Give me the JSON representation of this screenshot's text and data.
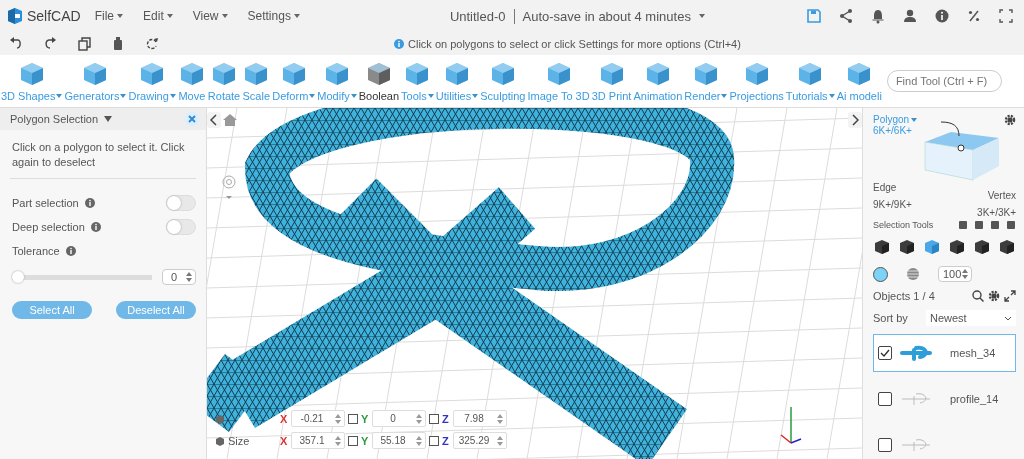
{
  "app": {
    "logo": "SelfCAD",
    "menus": [
      {
        "label": "File"
      },
      {
        "label": "Edit"
      },
      {
        "label": "View"
      },
      {
        "label": "Settings"
      }
    ],
    "document_title": "Untitled-0",
    "autosave": "Auto-save in about 4 minutes"
  },
  "hint": "Click on polygons to select or click Settings for more options (Ctrl+4)",
  "tools": [
    {
      "label": "3D Shapes",
      "dropdown": true,
      "muted": false
    },
    {
      "label": "Generators",
      "dropdown": true,
      "muted": false
    },
    {
      "label": "Drawing",
      "dropdown": true,
      "muted": false
    },
    {
      "label": "Move",
      "dropdown": false,
      "muted": false
    },
    {
      "label": "Rotate",
      "dropdown": false,
      "muted": false
    },
    {
      "label": "Scale",
      "dropdown": false,
      "muted": false
    },
    {
      "label": "Deform",
      "dropdown": true,
      "muted": false
    },
    {
      "label": "Modify",
      "dropdown": true,
      "muted": false
    },
    {
      "label": "Boolean",
      "dropdown": false,
      "muted": true
    },
    {
      "label": "Tools",
      "dropdown": true,
      "muted": false
    },
    {
      "label": "Utilities",
      "dropdown": true,
      "muted": false
    },
    {
      "label": "Sculpting",
      "dropdown": false,
      "muted": false
    },
    {
      "label": "Image To 3D",
      "dropdown": false,
      "muted": false
    },
    {
      "label": "3D Print",
      "dropdown": false,
      "muted": false
    },
    {
      "label": "Animation",
      "dropdown": false,
      "muted": false
    },
    {
      "label": "Render",
      "dropdown": true,
      "muted": false
    },
    {
      "label": "Projections",
      "dropdown": false,
      "muted": false
    },
    {
      "label": "Tutorials",
      "dropdown": true,
      "muted": false
    },
    {
      "label": "Ai modeli",
      "dropdown": false,
      "muted": false
    }
  ],
  "find_tool": {
    "placeholder": "Find Tool (Ctrl + F)"
  },
  "panel": {
    "title": "Polygon Selection",
    "description": "Click on a polygon to select it. Click again to deselect",
    "options": [
      {
        "kind": "toggle",
        "label": "Part selection",
        "on": false
      },
      {
        "kind": "toggle",
        "label": "Deep selection",
        "on": false
      },
      {
        "kind": "slider",
        "label": "Tolerance",
        "level": 0,
        "value": "0"
      }
    ],
    "buttons": [
      "Select All",
      "Deselect All"
    ]
  },
  "transform": [
    {
      "fields": [
        {
          "axis": "X",
          "value": "-0.21"
        },
        {
          "axis": "Y",
          "value": "0",
          "locked": false
        },
        {
          "axis": "Z",
          "value": "7.98",
          "locked": false
        }
      ]
    },
    {
      "label": "Size",
      "fields": [
        {
          "axis": "X",
          "value": "357.1"
        },
        {
          "axis": "Y",
          "value": "55.18",
          "locked": false
        },
        {
          "axis": "Z",
          "value": "325.29",
          "locked": false
        }
      ]
    }
  ],
  "selection": {
    "mode": "Polygon",
    "mode_count": "6K+/6K+",
    "edge": "Edge",
    "edge_count": "9K+/9K+",
    "vertex": "Vertex",
    "vertex_count": "3K+/3K+"
  },
  "selection_tools": {
    "label": "Selection Tools",
    "modes": [
      {
        "selected": false
      },
      {
        "selected": false
      },
      {
        "selected": true
      },
      {
        "selected": false
      },
      {
        "selected": false
      },
      {
        "selected": false
      }
    ],
    "size": "100"
  },
  "objects": {
    "count": "Objects 1 / 4",
    "sort_label": "Sort by",
    "sort_value": "Newest",
    "items": [
      {
        "name": "mesh_34",
        "checked": true,
        "selected": true
      },
      {
        "name": "profile_14",
        "checked": false,
        "selected": false
      },
      {
        "checked": false,
        "selected": false
      }
    ]
  }
}
